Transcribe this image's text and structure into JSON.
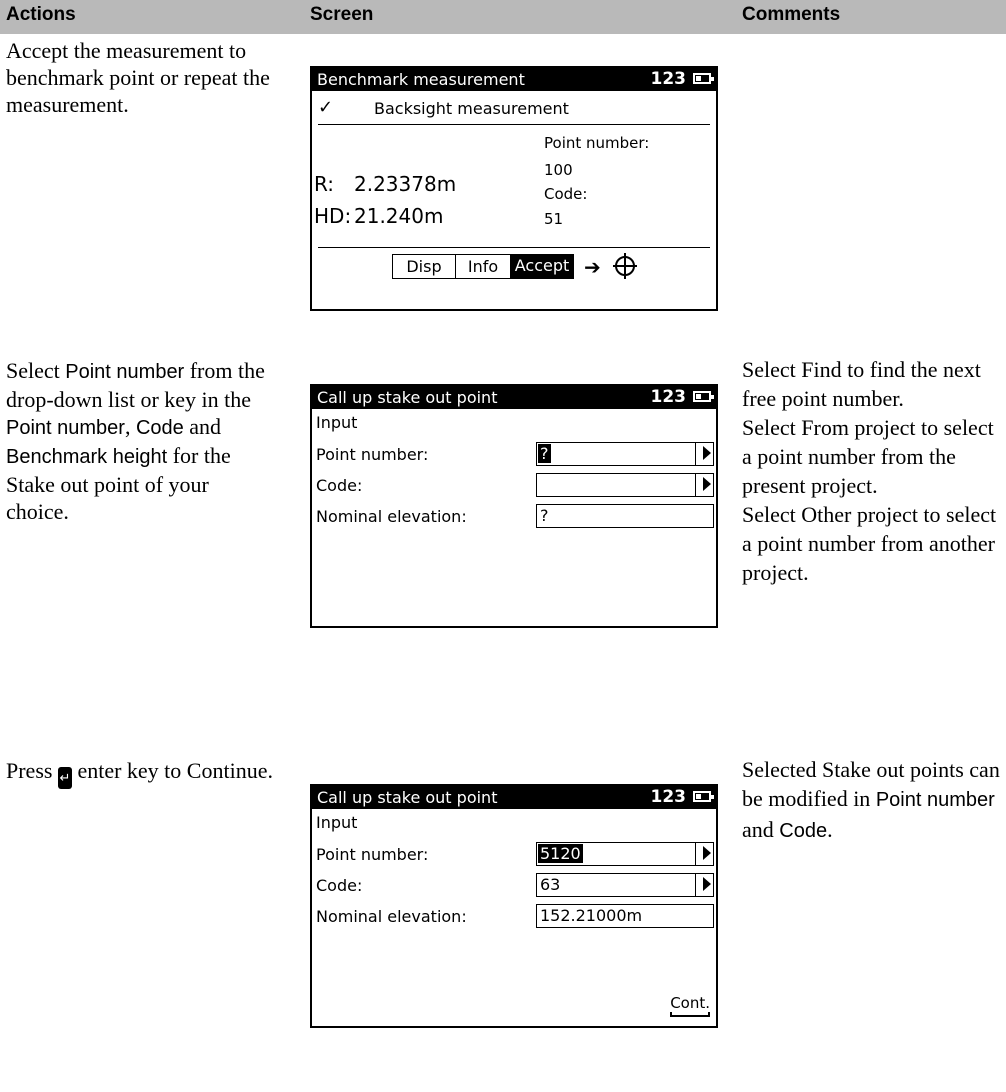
{
  "header": {
    "actions": "Actions",
    "screen": "Screen",
    "comments": "Comments"
  },
  "row1": {
    "action": "Accept the measurement to benchmark point or repeat the measurement.",
    "screen": {
      "title": "Benchmark measurement",
      "badge": "123",
      "check": "✓",
      "subtitle": "Backsight measurement",
      "point_number_label": "Point number:",
      "point_number_value": "100",
      "code_label": "Code:",
      "code_value": "51",
      "r_label": "R:",
      "r_value": "2.23378m",
      "hd_label": "HD:",
      "hd_value": "21.240m",
      "softkeys": [
        "Disp",
        "Info",
        "Accept"
      ],
      "arrow_icon": "➔"
    }
  },
  "row2": {
    "action": {
      "t1": "Select ",
      "s1": "Point number",
      "t2": " from the drop-down list or key in the ",
      "s2": "Point number",
      "t3": ", ",
      "s3": "Code",
      "t4": " and ",
      "s4": "Benchmark height",
      "t5": " for the Stake out point of your choice."
    },
    "screen": {
      "title": "Call up stake out point",
      "badge": "123",
      "section": "Input",
      "point_number_label": "Point number:",
      "point_number_value": "?",
      "code_label": "Code:",
      "code_value": "",
      "nominal_label": "Nominal elevation:",
      "nominal_value": "?"
    },
    "comments": [
      "Select Find to find the next free point number.",
      "Select From project to select a point number from the present project.",
      "Select Other project to select a point number from another project."
    ]
  },
  "row3": {
    "action": {
      "t1": "Press ",
      "t2": " enter key to Continue."
    },
    "screen": {
      "title": "Call up stake out point",
      "badge": "123",
      "section": "Input",
      "point_number_label": "Point number:",
      "point_number_value": "5120",
      "code_label": "Code:",
      "code_value": "63",
      "nominal_label": "Nominal elevation:",
      "nominal_value": "152.21000m",
      "softkey": "Cont."
    },
    "comment": {
      "t1": "Selected Stake out points can be modified in ",
      "s1": "Point number",
      "t2": " and ",
      "s2": "Code",
      "t3": "."
    }
  }
}
